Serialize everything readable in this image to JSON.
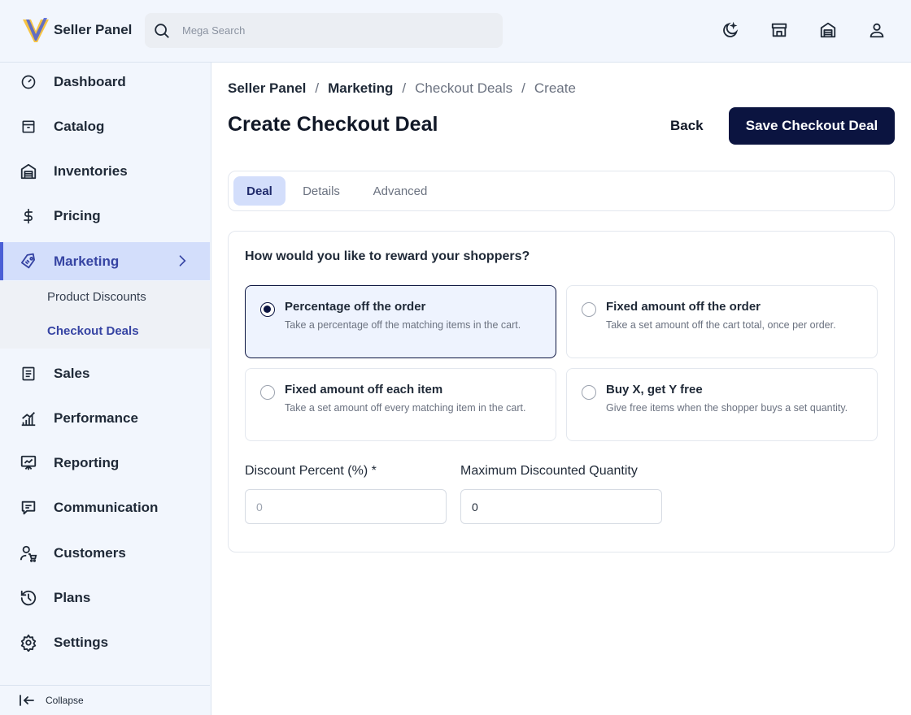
{
  "header": {
    "brand": "Seller Panel",
    "search_placeholder": "Mega Search"
  },
  "sidebar": {
    "items": [
      {
        "label": "Dashboard",
        "icon": "dashboard-gauge-icon"
      },
      {
        "label": "Catalog",
        "icon": "catalog-box-icon"
      },
      {
        "label": "Inventories",
        "icon": "warehouse-icon"
      },
      {
        "label": "Pricing",
        "icon": "dollar-icon"
      },
      {
        "label": "Marketing",
        "icon": "tag-icon"
      },
      {
        "label": "Sales",
        "icon": "receipt-icon"
      },
      {
        "label": "Performance",
        "icon": "bar-chart-icon"
      },
      {
        "label": "Reporting",
        "icon": "presentation-icon"
      },
      {
        "label": "Communication",
        "icon": "message-icon"
      },
      {
        "label": "Customers",
        "icon": "customer-cart-icon"
      },
      {
        "label": "Plans",
        "icon": "history-icon"
      },
      {
        "label": "Settings",
        "icon": "gear-icon"
      }
    ],
    "marketing_sub": [
      "Product Discounts",
      "Checkout Deals"
    ],
    "collapse_label": "Collapse"
  },
  "breadcrumb": {
    "items": [
      "Seller Panel",
      "Marketing",
      "Checkout Deals",
      "Create"
    ],
    "separator": "/"
  },
  "page": {
    "title": "Create Checkout Deal",
    "back_label": "Back",
    "save_label": "Save Checkout Deal"
  },
  "tabs": [
    "Deal",
    "Details",
    "Advanced"
  ],
  "form": {
    "question": "How would you like to reward your shoppers?",
    "options": [
      {
        "title": "Percentage off the order",
        "desc": "Take a percentage off the matching items in the cart.",
        "selected": true
      },
      {
        "title": "Fixed amount off the order",
        "desc": "Take a set amount off the cart total, once per order.",
        "selected": false
      },
      {
        "title": "Fixed amount off each item",
        "desc": "Take a set amount off every matching item in the cart.",
        "selected": false
      },
      {
        "title": "Buy X, get Y free",
        "desc": "Give free items when the shopper buys a set quantity.",
        "selected": false
      }
    ],
    "discount_percent_label": "Discount Percent (%) *",
    "discount_percent_placeholder": "0",
    "max_qty_label": "Maximum Discounted Quantity",
    "max_qty_value": "0"
  },
  "colors": {
    "primary": "#0b1440",
    "accent": "#3644a3",
    "active_bg": "#d3defb",
    "logo_yellow": "#f6c343",
    "logo_blue": "#4a5fd6"
  }
}
